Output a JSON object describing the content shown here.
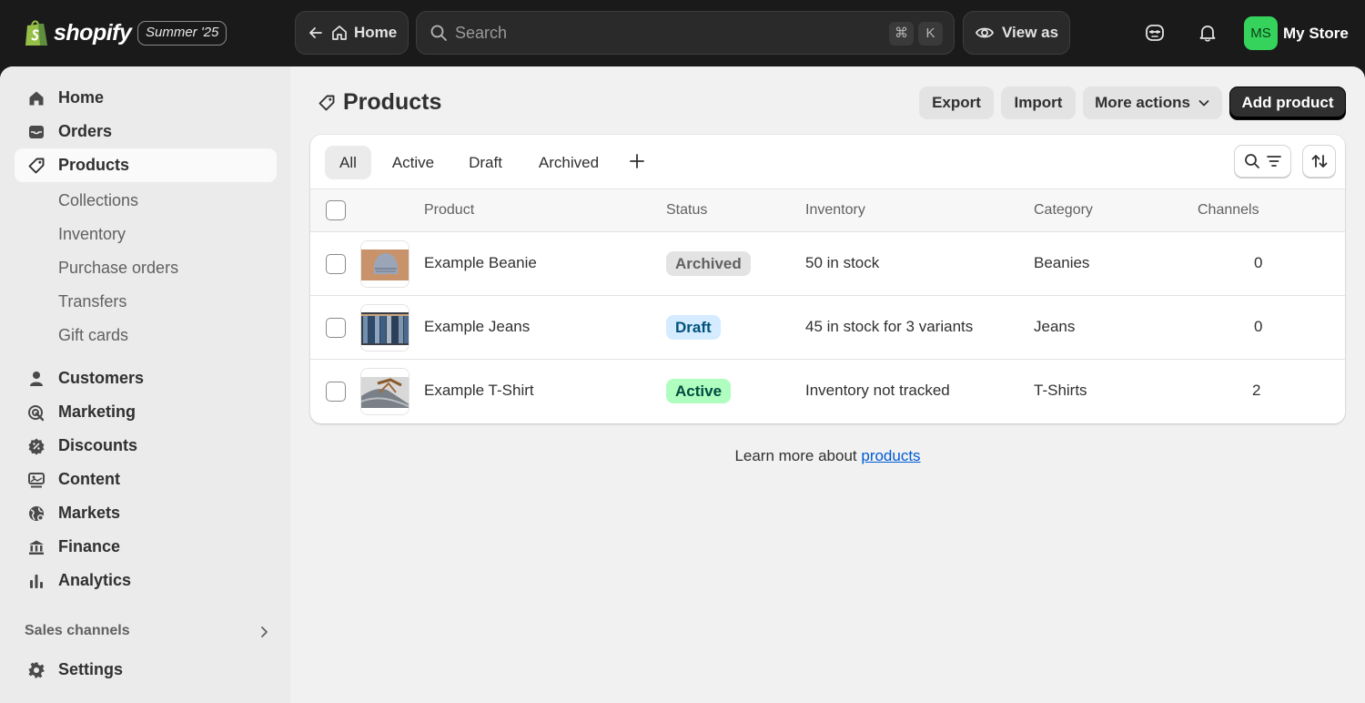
{
  "topbar": {
    "brand": "shopify",
    "edition": "Summer '25",
    "home_label": "Home",
    "search_placeholder": "Search",
    "shortcut_cmd": "⌘",
    "shortcut_key": "K",
    "view_as_label": "View as",
    "avatar_initials": "MS",
    "store_name": "My Store"
  },
  "sidebar": {
    "items": [
      {
        "label": "Home",
        "icon": "home-icon"
      },
      {
        "label": "Orders",
        "icon": "inbox-icon"
      },
      {
        "label": "Products",
        "icon": "tag-icon",
        "active": true
      }
    ],
    "product_subitems": [
      "Collections",
      "Inventory",
      "Purchase orders",
      "Transfers",
      "Gift cards"
    ],
    "more_items": [
      {
        "label": "Customers",
        "icon": "person-icon"
      },
      {
        "label": "Marketing",
        "icon": "target-icon"
      },
      {
        "label": "Discounts",
        "icon": "discount-icon"
      },
      {
        "label": "Content",
        "icon": "content-icon"
      },
      {
        "label": "Markets",
        "icon": "globe-icon"
      },
      {
        "label": "Finance",
        "icon": "bank-icon"
      },
      {
        "label": "Analytics",
        "icon": "bar-chart-icon"
      }
    ],
    "sales_channels_label": "Sales channels",
    "settings_label": "Settings"
  },
  "page": {
    "title": "Products",
    "actions": {
      "export": "Export",
      "import": "Import",
      "more_actions": "More actions",
      "add_product": "Add product"
    }
  },
  "tabs": [
    "All",
    "Active",
    "Draft",
    "Archived"
  ],
  "table": {
    "columns": [
      "Product",
      "Status",
      "Inventory",
      "Category",
      "Channels"
    ],
    "rows": [
      {
        "product": "Example Beanie",
        "status": "Archived",
        "inventory": "50 in stock",
        "category": "Beanies",
        "channels": "0"
      },
      {
        "product": "Example Jeans",
        "status": "Draft",
        "inventory": "45 in stock for 3 variants",
        "category": "Jeans",
        "channels": "0"
      },
      {
        "product": "Example T-Shirt",
        "status": "Active",
        "inventory": "Inventory not tracked",
        "category": "T-Shirts",
        "channels": "2"
      }
    ]
  },
  "footer": {
    "learn_prefix": "Learn more about ",
    "learn_link": "products"
  },
  "colors": {
    "badge_archived_bg": "#e3e3e3",
    "badge_draft_bg": "#d5ebff",
    "badge_active_bg": "#affebf",
    "link": "#005bd3",
    "avatar_bg": "#36d35c"
  }
}
